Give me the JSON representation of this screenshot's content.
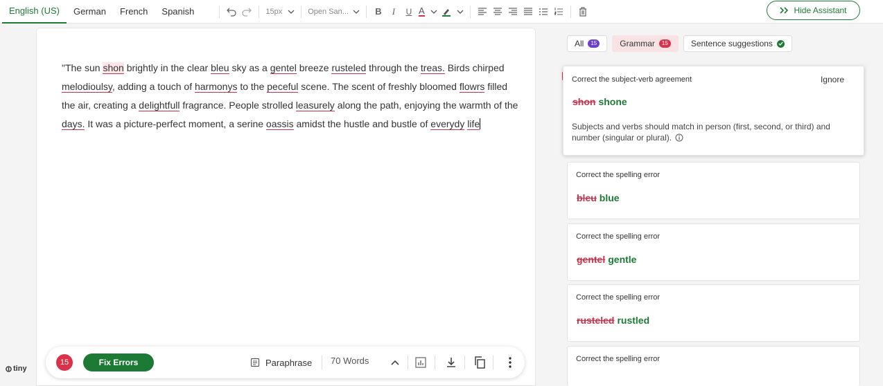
{
  "languages": [
    "English (US)",
    "German",
    "French",
    "Spanish"
  ],
  "toolbar": {
    "font_size": "15px",
    "font_family": "Open San...",
    "bold": "B",
    "italic": "I",
    "underline": "U",
    "text_color": "A"
  },
  "hide_assistant": "Hide Assistant",
  "editor": {
    "segments": [
      {
        "t": "\"The sun "
      },
      {
        "t": "shon",
        "err": true,
        "hl": true
      },
      {
        "t": " brightly in the clear "
      },
      {
        "t": "bleu",
        "err": true
      },
      {
        "t": " sky as a "
      },
      {
        "t": "gentel",
        "err": true
      },
      {
        "t": " breeze "
      },
      {
        "t": "rusteled",
        "err": true
      },
      {
        "t": " through the "
      },
      {
        "t": "treas.",
        "err": true
      },
      {
        "t": " Birds chirped "
      },
      {
        "t": "melodioulsy",
        "err": true
      },
      {
        "t": ", adding a touch of "
      },
      {
        "t": "harmonys",
        "err": true
      },
      {
        "t": " to the "
      },
      {
        "t": "peceful",
        "err": true
      },
      {
        "t": " scene. The scent of freshly bloomed "
      },
      {
        "t": "flowrs",
        "err": true
      },
      {
        "t": " filled the air, creating a "
      },
      {
        "t": "delightfull",
        "err": true
      },
      {
        "t": " fragrance. People strolled "
      },
      {
        "t": "leasurely",
        "err": true
      },
      {
        "t": " along the path, enjoying the warmth of the "
      },
      {
        "t": "days.",
        "err": true
      },
      {
        "t": " It was a picture-perfect moment, a serine "
      },
      {
        "t": "oassis",
        "err": true
      },
      {
        "t": " amidst the hustle and bustle of "
      },
      {
        "t": "everydy",
        "err": true
      },
      {
        "t": " "
      },
      {
        "t": "life",
        "err": true
      }
    ]
  },
  "bottom_bar": {
    "error_count": "15",
    "fix_errors": "Fix Errors",
    "paraphrase": "Paraphrase",
    "word_count": "70 Words"
  },
  "logo": "tiny",
  "filters": [
    {
      "label": "All",
      "count": "15",
      "color": "purple"
    },
    {
      "label": "Grammar",
      "count": "15",
      "color": "red"
    },
    {
      "label": "Sentence suggestions"
    }
  ],
  "cards": [
    {
      "title": "Correct the subject-verb agreement",
      "wrong": "shon",
      "right": "shone",
      "ignore": "Ignore",
      "desc": "Subjects and verbs should match in person (first, second, or third) and number (singular or plural)."
    },
    {
      "title": "Correct the spelling error",
      "wrong": "bleu",
      "right": "blue"
    },
    {
      "title": "Correct the spelling error",
      "wrong": "gentel",
      "right": "gentle"
    },
    {
      "title": "Correct the spelling error",
      "wrong": "rusteled",
      "right": "rustled"
    },
    {
      "title": "Correct the spelling error"
    }
  ],
  "colors": {
    "accent": "#1d7a35",
    "error": "#c8324a",
    "purple": "#6c3fd1"
  }
}
